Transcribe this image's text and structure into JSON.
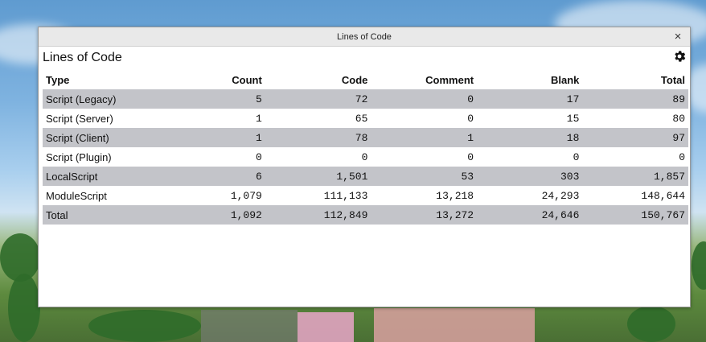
{
  "window": {
    "title": "Lines of Code",
    "close_glyph": "×",
    "heading": "Lines of Code",
    "settings_icon": "gear-icon"
  },
  "table": {
    "columns": [
      "Type",
      "Count",
      "Code",
      "Comment",
      "Blank",
      "Total"
    ],
    "rows": [
      {
        "type": "Script (Legacy)",
        "count": "5",
        "code": "72",
        "comment": "0",
        "blank": "17",
        "total": "89"
      },
      {
        "type": "Script (Server)",
        "count": "1",
        "code": "65",
        "comment": "0",
        "blank": "15",
        "total": "80"
      },
      {
        "type": "Script (Client)",
        "count": "1",
        "code": "78",
        "comment": "1",
        "blank": "18",
        "total": "97"
      },
      {
        "type": "Script (Plugin)",
        "count": "0",
        "code": "0",
        "comment": "0",
        "blank": "0",
        "total": "0"
      },
      {
        "type": "LocalScript",
        "count": "6",
        "code": "1,501",
        "comment": "53",
        "blank": "303",
        "total": "1,857"
      },
      {
        "type": "ModuleScript",
        "count": "1,079",
        "code": "111,133",
        "comment": "13,218",
        "blank": "24,293",
        "total": "148,644"
      },
      {
        "type": "Total",
        "count": "1,092",
        "code": "112,849",
        "comment": "13,272",
        "blank": "24,646",
        "total": "150,767"
      }
    ]
  },
  "colors": {
    "row_alt": "#c3c4c9",
    "titlebar": "#e9e9e9"
  }
}
